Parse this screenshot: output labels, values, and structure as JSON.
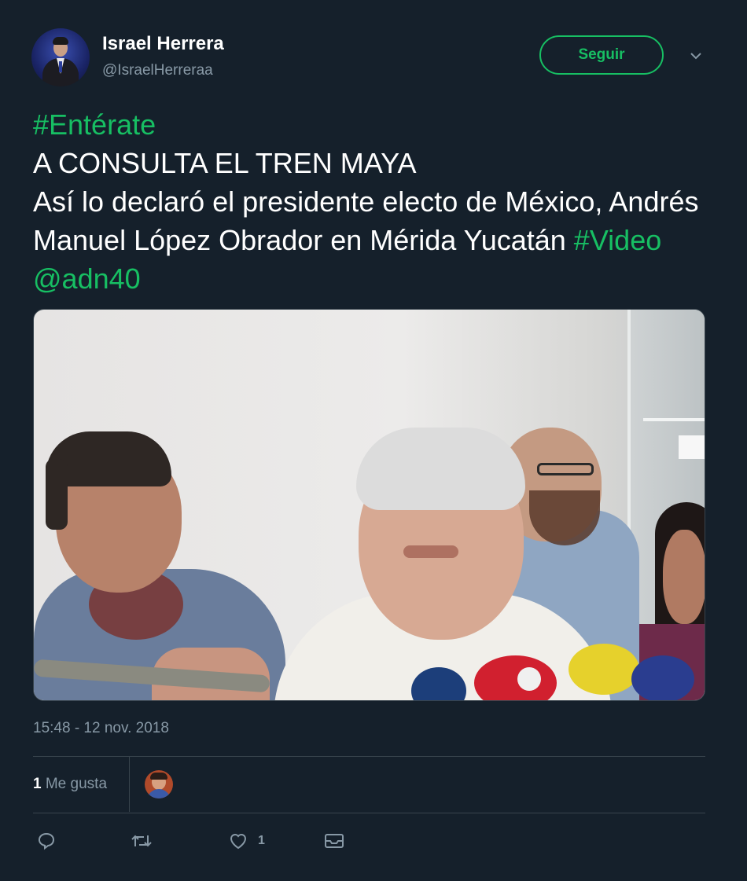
{
  "user": {
    "name": "Israel Herrera",
    "handle": "@IsraelHerreraa"
  },
  "actions_header": {
    "follow_label": "Seguir",
    "menu_icon": "chevron-down-icon"
  },
  "tweet": {
    "hashtag1": "#Entérate",
    "line2": "A CONSULTA EL TREN MAYA",
    "body": "Así lo declaró el presidente electo de México, Andrés Manuel López Obrador en Mérida Yucatán",
    "hashtag2": "#Video",
    "mention": "@adn40"
  },
  "meta": {
    "timestamp": "15:48 - 12 nov. 2018",
    "likes_number": "1",
    "likes_label": "Me gusta"
  },
  "actions": {
    "reply_icon": "reply-icon",
    "retweet_icon": "retweet-icon",
    "like_icon": "heart-icon",
    "like_count": "1",
    "dm_icon": "envelope-icon"
  },
  "colors": {
    "background": "#15202b",
    "accent": "#17bf63",
    "secondary_text": "#8899a6",
    "divider": "#38444d"
  }
}
